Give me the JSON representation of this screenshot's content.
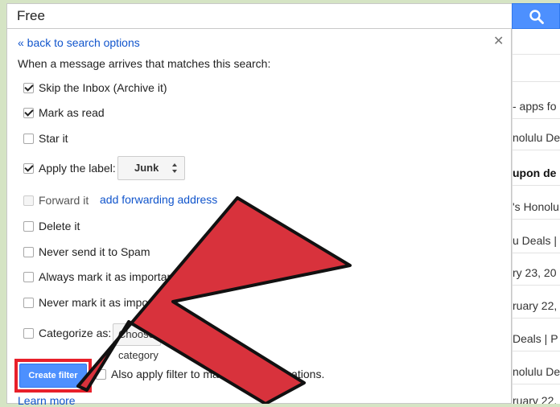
{
  "search": {
    "query": "Free"
  },
  "panel": {
    "back_link": "« back to search options",
    "intro": "When a message arrives that matches this search:",
    "options": {
      "skip_inbox": "Skip the Inbox (Archive it)",
      "mark_read": "Mark as read",
      "star": "Star it",
      "apply_label": "Apply the label:",
      "label_value": "Junk",
      "forward": "Forward it",
      "add_forwarding": "add forwarding address",
      "delete": "Delete it",
      "never_spam": "Never send it to Spam",
      "always_important": "Always mark it as important",
      "never_important": "Never mark it as important",
      "categorize": "Categorize as:",
      "category_value": "Choose category"
    },
    "create_filter": "Create filter",
    "also_apply": "Also apply filter to matching conversations.",
    "learn_more": "Learn more"
  },
  "background_list": {
    "rows": [
      "- apps fo",
      "nolulu De",
      "upon de",
      "'s Honolu",
      "u Deals |",
      "ry 23, 20",
      "ruary 22,",
      "Deals | P",
      "nolulu De",
      "ruary 22,"
    ]
  },
  "colors": {
    "accent": "#4d90fe",
    "highlight": "#e8202a",
    "arrow_fill": "#d8323c",
    "link": "#1155cc"
  },
  "icons": [
    "search-icon",
    "close-icon",
    "checkbox-icon",
    "select-arrows-icon",
    "pointer-arrow"
  ]
}
